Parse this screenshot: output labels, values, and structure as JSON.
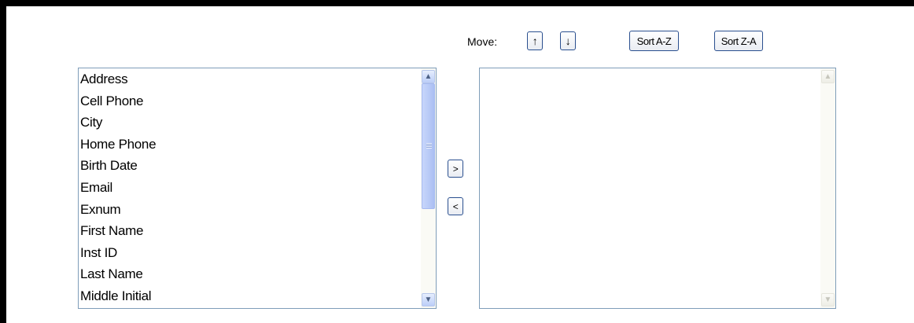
{
  "toolbar": {
    "move_label": "Move:",
    "move_up": "↑",
    "move_down": "↓",
    "sort_az": "Sort A-Z",
    "sort_za": "Sort Z-A"
  },
  "transfer": {
    "add": ">",
    "remove": "<"
  },
  "available_fields": [
    "Address",
    "Cell Phone",
    "City",
    "Home Phone",
    "Birth Date",
    "Email",
    "Exnum",
    "First Name",
    "Inst ID",
    "Last Name",
    "Middle Initial"
  ],
  "selected_fields": [],
  "icons": {
    "scroll_up": "scroll-up-arrow-icon",
    "scroll_down": "scroll-down-arrow-icon"
  },
  "colors": {
    "frame": "#000000",
    "listbox_border": "#7f9db9",
    "button_border": "#2a4f8f",
    "scroll_thumb": "#b7c9f6"
  }
}
